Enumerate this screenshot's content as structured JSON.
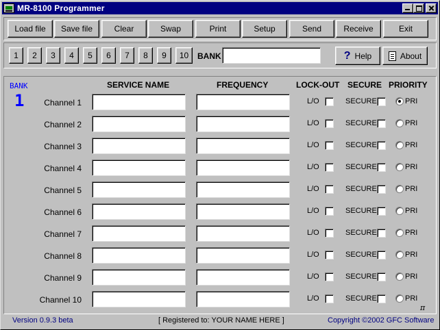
{
  "window": {
    "title": "MR-8100  Programmer"
  },
  "toolbar": {
    "buttons": [
      {
        "label": "Load file"
      },
      {
        "label": "Save file"
      },
      {
        "label": "Clear"
      },
      {
        "label": "Swap"
      },
      {
        "label": "Print"
      },
      {
        "label": "Setup"
      },
      {
        "label": "Send"
      },
      {
        "label": "Receive"
      },
      {
        "label": "Exit"
      }
    ]
  },
  "bank_bar": {
    "numbers": [
      "1",
      "2",
      "3",
      "4",
      "5",
      "6",
      "7",
      "8",
      "9",
      "10"
    ],
    "bank_label": "BANK",
    "bank_value": "",
    "help_label": "Help",
    "about_label": "About"
  },
  "panel": {
    "bank_tag": "BANK",
    "bank_number": "1",
    "headers": {
      "service_name": "SERVICE NAME",
      "frequency": "FREQUENCY",
      "lockout": "LOCK-OUT",
      "secure": "SECURE",
      "priority": "PRIORITY"
    },
    "lockout_label": "L/O",
    "secure_label": "SECURE",
    "priority_label": "PRI",
    "pi_symbol": "π",
    "channels": [
      {
        "label": "Channel 1",
        "service": "",
        "frequency": "",
        "lockout": false,
        "secure": false,
        "priority": true
      },
      {
        "label": "Channel 2",
        "service": "",
        "frequency": "",
        "lockout": false,
        "secure": false,
        "priority": false
      },
      {
        "label": "Channel 3",
        "service": "",
        "frequency": "",
        "lockout": false,
        "secure": false,
        "priority": false
      },
      {
        "label": "Channel 4",
        "service": "",
        "frequency": "",
        "lockout": false,
        "secure": false,
        "priority": false
      },
      {
        "label": "Channel 5",
        "service": "",
        "frequency": "",
        "lockout": false,
        "secure": false,
        "priority": false
      },
      {
        "label": "Channel 6",
        "service": "",
        "frequency": "",
        "lockout": false,
        "secure": false,
        "priority": false
      },
      {
        "label": "Channel 7",
        "service": "",
        "frequency": "",
        "lockout": false,
        "secure": false,
        "priority": false
      },
      {
        "label": "Channel 8",
        "service": "",
        "frequency": "",
        "lockout": false,
        "secure": false,
        "priority": false
      },
      {
        "label": "Channel 9",
        "service": "",
        "frequency": "",
        "lockout": false,
        "secure": false,
        "priority": false
      },
      {
        "label": "Channel 10",
        "service": "",
        "frequency": "",
        "lockout": false,
        "secure": false,
        "priority": false
      }
    ]
  },
  "status": {
    "version": "Version 0.9.3 beta",
    "registered": "[ Registered to:  YOUR NAME HERE ]",
    "copyright": "Copyright ©2002 GFC Software"
  },
  "colors": {
    "titlebar": "#000080",
    "face": "#c0c0c0",
    "accent_blue": "#0000ff"
  }
}
